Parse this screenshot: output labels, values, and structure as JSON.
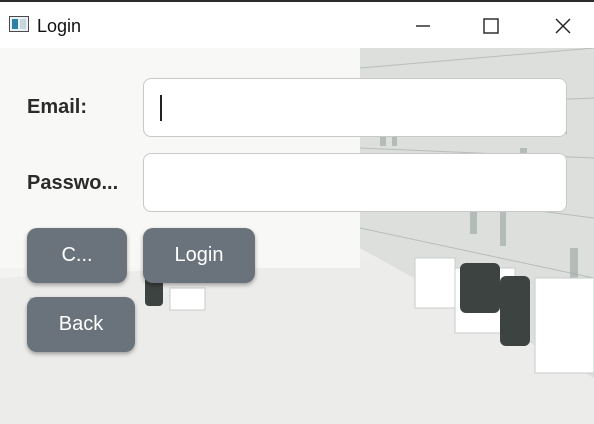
{
  "window": {
    "title": "Login",
    "controls": [
      "minimize-icon",
      "maximize-icon",
      "close-icon"
    ]
  },
  "form": {
    "email_label": "Email:",
    "email_value": "",
    "password_label": "Passwo...",
    "password_value": ""
  },
  "buttons": {
    "create_label": "C...",
    "login_label": "Login",
    "back_label": "Back"
  },
  "colors": {
    "button_bg": "#6a737b",
    "label_text": "#2b2b2b"
  }
}
